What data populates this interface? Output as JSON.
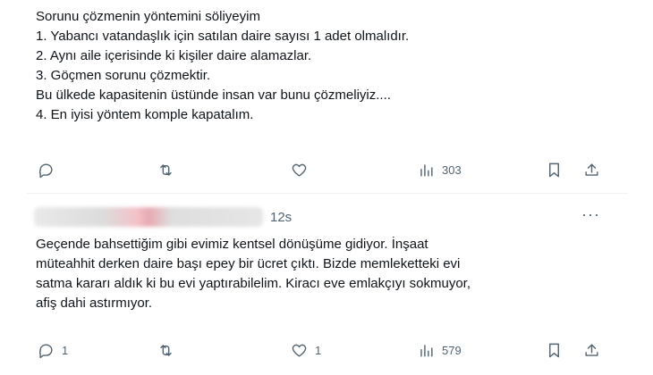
{
  "post1": {
    "lines": [
      "Sorunu çözmenin yöntemini söliyeyim",
      "1. Yabancı vatandaşlık için satılan daire sayısı 1 adet olmalıdır.",
      "2. Aynı aile içerisinde ki kişiler daire alamazlar.",
      "3. Göçmen sorunu çözmektir.",
      "Bu ülkede kapasitenin üstünde insan var bunu çözmeliyiz....",
      "4. En iyisi yöntem komple kapatalım."
    ],
    "actions": {
      "reply_count": "",
      "repost_count": "",
      "like_count": "",
      "views_count": "303"
    }
  },
  "post2": {
    "time": "12s",
    "lines": [
      "Geçende bahsettiğim gibi evimiz kentsel dönüşüme gidiyor. İnşaat",
      "müteahhit derken daire başı epey bir ücret çıktı. Bizde memleketteki evi",
      "satma kararı aldık ki bu evi yaptırabilelim. Kiracı eve emlakçıyı sokmuyor,",
      "afiş dahi astırmıyor."
    ],
    "actions": {
      "reply_count": "1",
      "repost_count": "",
      "like_count": "1",
      "views_count": "579"
    },
    "more": "···"
  },
  "icons": {
    "reply": "reply-bubble-icon",
    "repost": "repost-arrows-icon",
    "like": "heart-icon",
    "views": "bar-chart-icon",
    "bookmark": "bookmark-icon",
    "share": "share-upload-icon"
  }
}
